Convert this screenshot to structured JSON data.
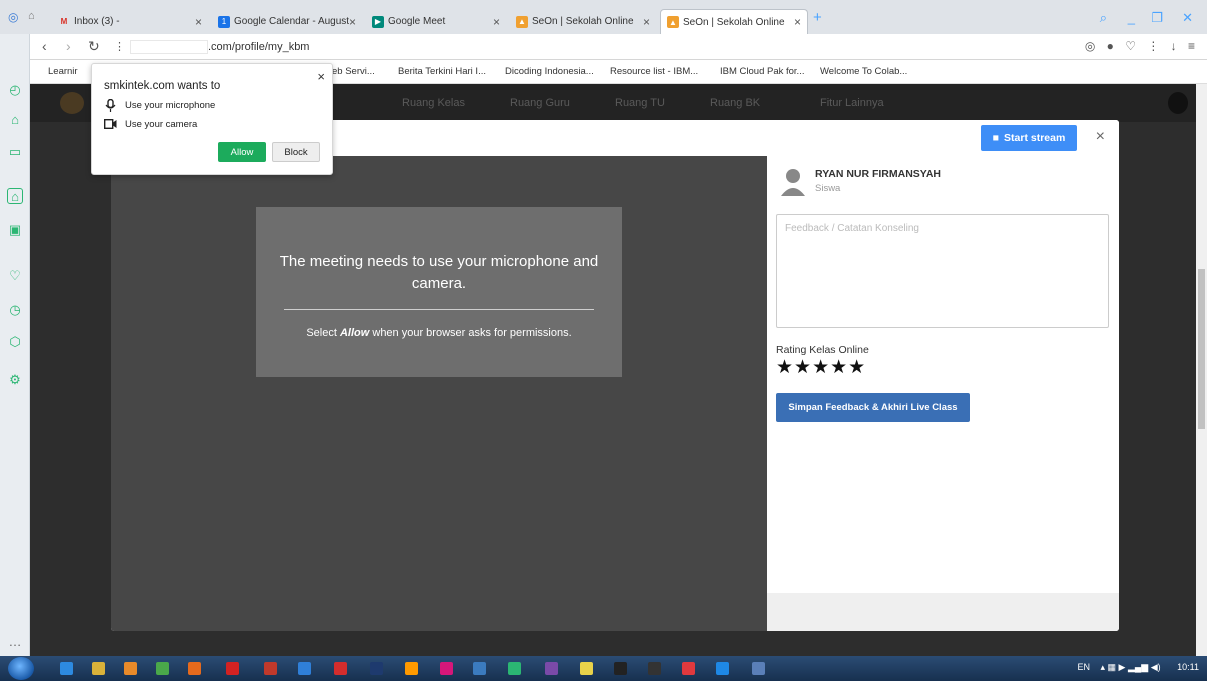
{
  "browser": {
    "tabs": [
      {
        "label": "Inbox (3) -",
        "close": "×"
      },
      {
        "label": "Google Calendar - August",
        "close": "×"
      },
      {
        "label": "Google Meet",
        "close": "×"
      },
      {
        "label": "SeOn | Sekolah Online",
        "close": "×"
      },
      {
        "label": "SeOn | Sekolah Online",
        "close": "×"
      }
    ],
    "new_tab": "+",
    "url_suffix": ".com/profile/my_kbm",
    "bookmarks": [
      "Learnir",
      "eb Servi...",
      "Berita Terkini Hari I...",
      "Dicoding Indonesia...",
      "Resource list - IBM...",
      "IBM Cloud Pak for...",
      "Welcome To Colab..."
    ]
  },
  "site_nav": [
    "Ruang Kelas",
    "Ruang Guru",
    "Ruang TU",
    "Ruang BK",
    "Fitur Lainnya"
  ],
  "permission_popup": {
    "title": "smkintek.com wants to",
    "items": [
      "Use your microphone",
      "Use your camera"
    ],
    "allow": "Allow",
    "block": "Block",
    "close": "×"
  },
  "modal": {
    "start_stream": "Start stream",
    "close": "×",
    "video_notice": {
      "title": "The meeting needs to use your microphone and camera.",
      "sub_pre": "Select ",
      "sub_em": "Allow",
      "sub_post": " when your browser asks for permissions."
    },
    "student": {
      "name": "RYAN NUR FIRMANSYAH",
      "role": "Siswa"
    },
    "feedback_placeholder": "Feedback / Catatan Konseling",
    "rating_label": "Rating Kelas Online",
    "rating_stars": "★★★★★",
    "rating_value": 5,
    "save_button": "Simpan Feedback & Akhiri Live Class"
  },
  "taskbar": {
    "lang": "EN",
    "time": "10:11"
  },
  "colors": {
    "allow": "#1cab5c",
    "start_stream": "#3e8ef7",
    "save": "#3a6fb5",
    "rail_icon": "#2bb673"
  }
}
